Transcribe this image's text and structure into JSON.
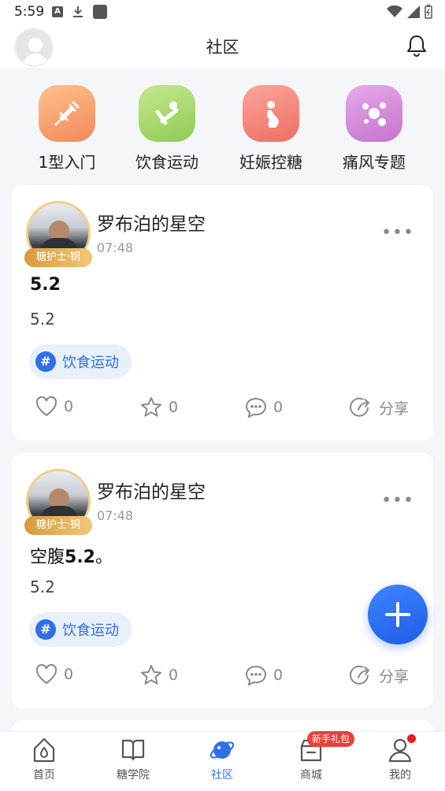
{
  "status_bar": {
    "time": "5:59",
    "a_icon_letter": "A"
  },
  "header": {
    "title": "社区"
  },
  "categories": [
    {
      "label": "1型入门",
      "icon": "syringe-icon",
      "color": "#f4a06a"
    },
    {
      "label": "饮食运动",
      "icon": "exercise-icon",
      "color": "#a6d86b"
    },
    {
      "label": "妊娠控糖",
      "icon": "pregnancy-icon",
      "color": "#f3857b"
    },
    {
      "label": "痛风专题",
      "icon": "molecule-icon",
      "color": "#d38bd8"
    }
  ],
  "posts": [
    {
      "author": "罗布泊的星空",
      "badge": "糖护士·铜",
      "time": "07:48",
      "title_prefix": "",
      "title_bold": "5.2",
      "title_suffix": "",
      "body": "5.2",
      "topic": "饮食运动",
      "likes": "0",
      "favorites": "0",
      "comments": "0",
      "share_label": "分享"
    },
    {
      "author": "罗布泊的星空",
      "badge": "糖护士·铜",
      "time": "07:48",
      "title_prefix": "空腹",
      "title_bold": "5.2",
      "title_suffix": "。",
      "body": "5.2",
      "topic": "饮食运动",
      "likes": "0",
      "favorites": "0",
      "comments": "0",
      "share_label": "分享"
    }
  ],
  "tabbar": {
    "items": [
      {
        "label": "首页",
        "icon": "home-icon"
      },
      {
        "label": "糖学院",
        "icon": "book-icon"
      },
      {
        "label": "社区",
        "icon": "planet-icon",
        "active": true
      },
      {
        "label": "商城",
        "icon": "shop-icon"
      },
      {
        "label": "我的",
        "icon": "user-icon"
      }
    ],
    "gift_badge": "新手礼包"
  },
  "colors": {
    "accent": "#2f6fe8",
    "badge_red": "#e8413c"
  }
}
